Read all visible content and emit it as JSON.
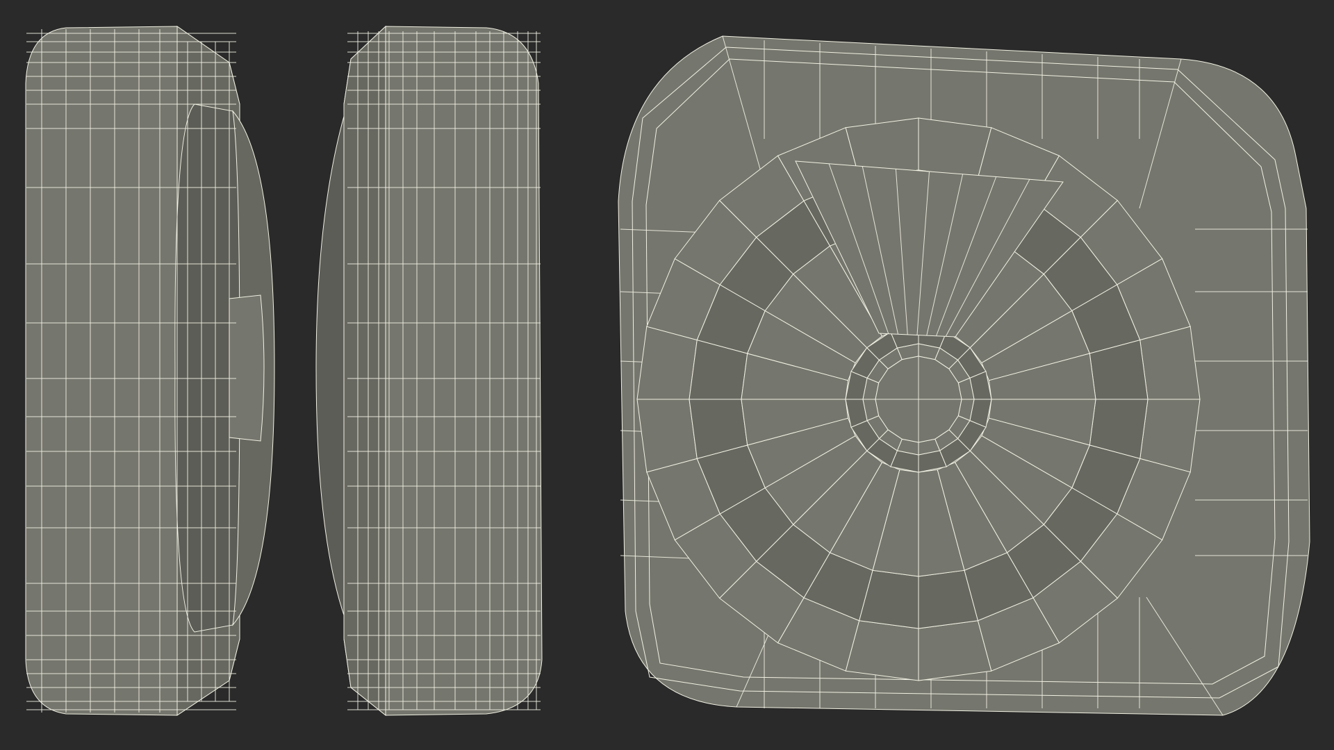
{
  "scene": {
    "background": "#2a2a2a",
    "body_color": "#75766d",
    "body_shade": "#676860",
    "body_dark": "#5c5d56",
    "wire_color": "#f2f1e4"
  },
  "views": [
    {
      "name": "side-view-left"
    },
    {
      "name": "side-view-right"
    },
    {
      "name": "front-view"
    }
  ]
}
